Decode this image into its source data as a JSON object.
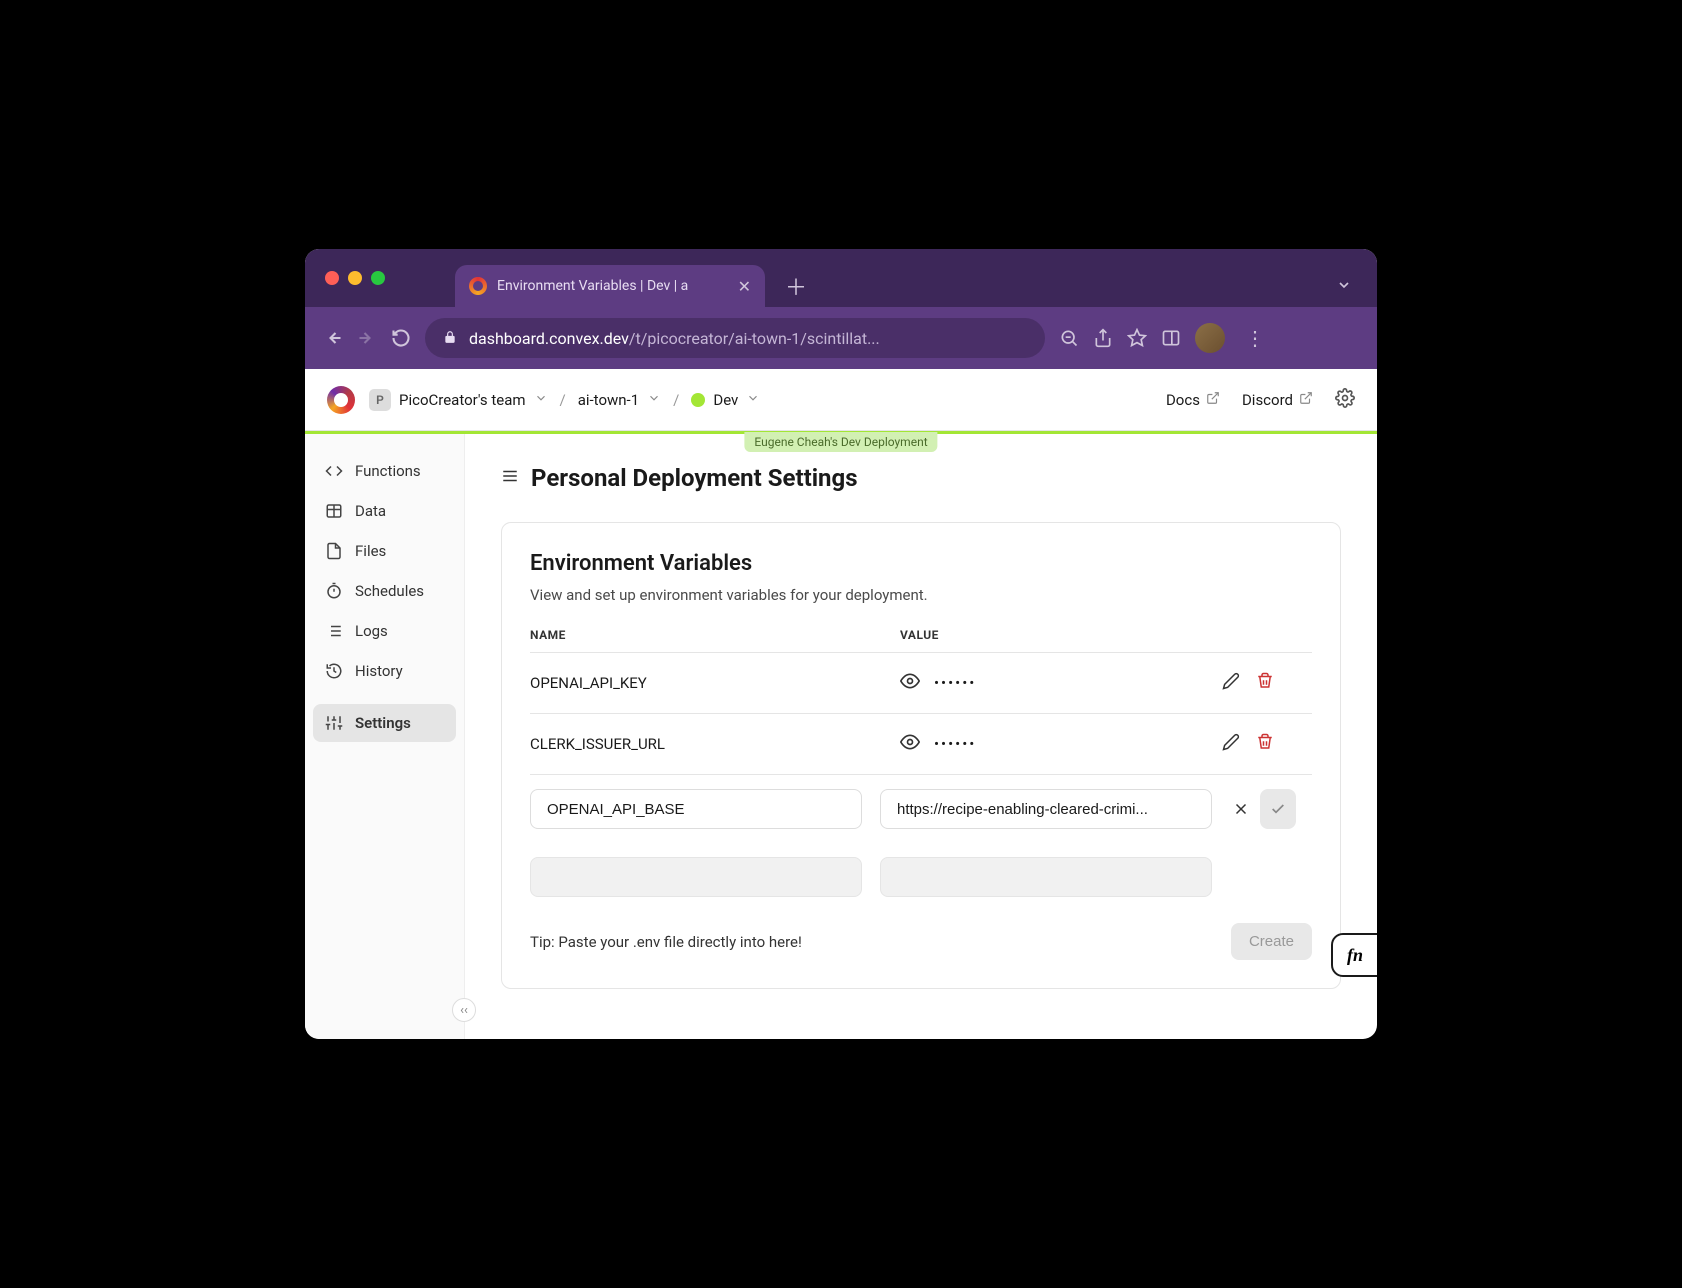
{
  "browser": {
    "tab_title": "Environment Variables | Dev | a",
    "url_domain": "dashboard.convex.dev",
    "url_path": "/t/picocreator/ai-town-1/scintillat..."
  },
  "header": {
    "team_initial": "P",
    "team_name": "PicoCreator's team",
    "project": "ai-town-1",
    "env_label": "Dev",
    "docs_label": "Docs",
    "discord_label": "Discord",
    "deployment_badge": "Eugene Cheah's Dev Deployment"
  },
  "sidebar": {
    "items": [
      {
        "label": "Functions"
      },
      {
        "label": "Data"
      },
      {
        "label": "Files"
      },
      {
        "label": "Schedules"
      },
      {
        "label": "Logs"
      },
      {
        "label": "History"
      },
      {
        "label": "Settings"
      }
    ]
  },
  "page": {
    "title": "Personal Deployment Settings",
    "card_title": "Environment Variables",
    "card_desc": "View and set up environment variables for your deployment.",
    "col_name": "NAME",
    "col_value": "VALUE",
    "rows": [
      {
        "name": "OPENAI_API_KEY",
        "value": "••••••"
      },
      {
        "name": "CLERK_ISSUER_URL",
        "value": "••••••"
      }
    ],
    "new_row": {
      "name": "OPENAI_API_BASE",
      "value": "https://recipe-enabling-cleared-crimi..."
    },
    "tip": "Tip: Paste your .env file directly into here!",
    "create_label": "Create",
    "fn_label": "fn"
  }
}
